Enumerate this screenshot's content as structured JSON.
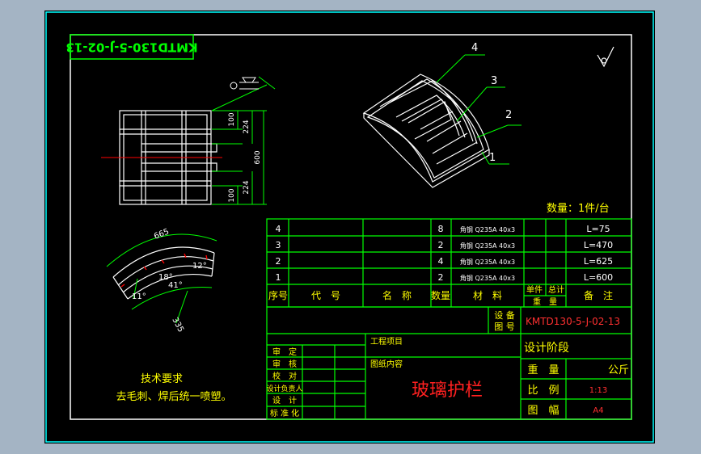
{
  "drawing": {
    "title_block_code_rotated": "KMTD130-5-J-02-13",
    "quantity_note": "数量：1件/台",
    "roughness_symbol": "roughness-icon",
    "part_labels": [
      "4",
      "3",
      "2",
      "1"
    ],
    "front_view_dims": {
      "d100_top": "100",
      "d224_top": "224",
      "d600": "600",
      "d100_bottom": "100",
      "d224_bottom": "224"
    },
    "arc_view_dims": {
      "len_top": "665",
      "len_side": "335",
      "angle_11": "11°",
      "angle_18": "18°",
      "angle_41": "41°",
      "angle_12": "12°"
    },
    "tech_requirements": {
      "title": "技术要求",
      "line1": "去毛刺、焊后统一喷塑。"
    }
  },
  "bom": {
    "rows": [
      {
        "no": "4",
        "code": "",
        "name": "",
        "qty": "8",
        "material": "角钢 Q235A 40x3",
        "single_total": "",
        "note": "L=75"
      },
      {
        "no": "3",
        "code": "",
        "name": "",
        "qty": "2",
        "material": "角钢 Q235A 40x3",
        "single_total": "",
        "note": "L=470"
      },
      {
        "no": "2",
        "code": "",
        "name": "",
        "qty": "4",
        "material": "角钢 Q235A 40x3",
        "single_total": "",
        "note": "L=625"
      },
      {
        "no": "1",
        "code": "",
        "name": "",
        "qty": "2",
        "material": "角钢 Q235A 40x3",
        "single_total": "",
        "note": "L=600"
      }
    ],
    "headers": {
      "no": "序号",
      "code": "代　号",
      "name": "名　称",
      "qty": "数量",
      "material": "材　料",
      "single": "单件",
      "total": "总计",
      "weight": "重　量",
      "note": "备　注"
    }
  },
  "title_block": {
    "drawing_no_label_1": "设 备",
    "drawing_no_label_2": "图 号",
    "drawing_no": "KMTD130-5-J-02-13",
    "project_label": "工程项目",
    "content_label": "图纸内容",
    "drawing_title": "玻璃护栏",
    "stage_label": "设计阶段",
    "weight_label": "重　量",
    "weight_unit": "公斤",
    "scale_label": "比　例",
    "scale_value": "1:13",
    "sheet_label": "图　幅",
    "sheet_value": "A4",
    "roles": [
      "审　定",
      "审　核",
      "校　对",
      "设计负责人",
      "设　计",
      "标 准 化"
    ]
  },
  "colors": {
    "line_white": "#ffffff",
    "line_green": "#00ff00",
    "line_cyan": "#00ffff",
    "line_red": "#ff0000",
    "text_yellow": "#ffff00",
    "text_red": "#ff2020",
    "background": "#000000",
    "outer_bg": "#a4b4c4"
  }
}
